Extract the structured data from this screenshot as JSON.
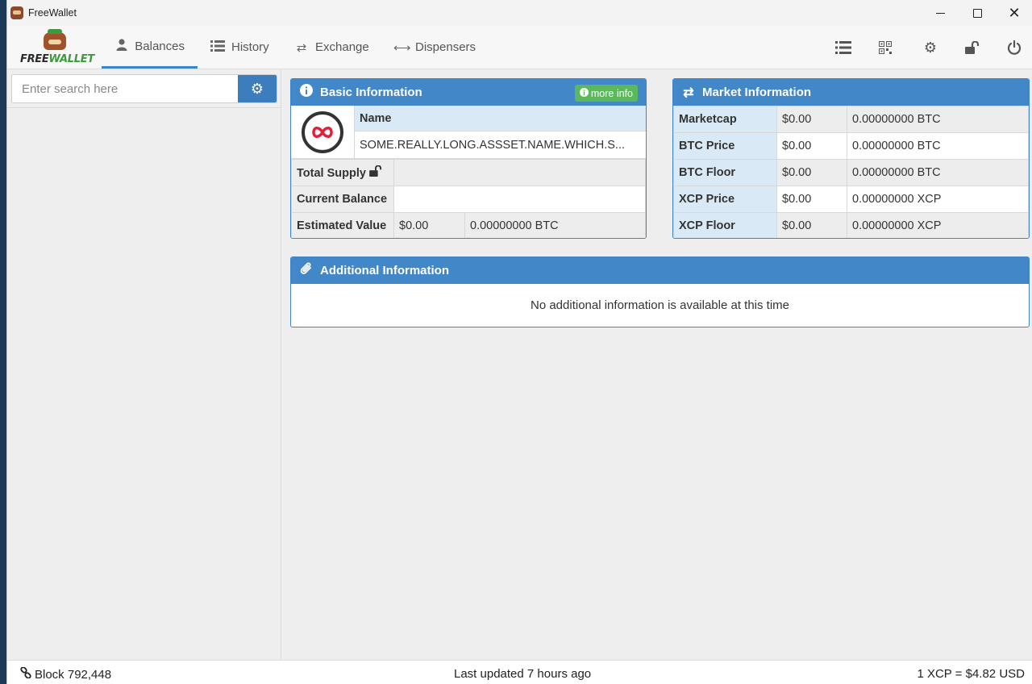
{
  "window": {
    "title": "FreeWallet",
    "icon": "freewallet-app-icon"
  },
  "logo": {
    "text_part1": "FREE",
    "text_part2": "WALLET"
  },
  "nav": {
    "tabs": [
      {
        "label": "Balances",
        "icon": "user-icon",
        "active": true
      },
      {
        "label": "History",
        "icon": "list-icon",
        "active": false
      },
      {
        "label": "Exchange",
        "icon": "exchange-arrows-icon",
        "active": false
      },
      {
        "label": "Dispensers",
        "icon": "left-right-arrow-icon",
        "active": false
      }
    ],
    "right_icons": [
      "list-icon",
      "qr-code-icon",
      "gears-icon",
      "unlock-icon",
      "power-icon"
    ]
  },
  "search": {
    "placeholder": "Enter search here"
  },
  "basic": {
    "title": "Basic Information",
    "more_info": "more info",
    "name_label": "Name",
    "name_value": "SOME.REALLY.LONG.ASSSET.NAME.WHICH.S...",
    "total_supply_label": "Total Supply",
    "current_balance_label": "Current Balance",
    "estimated_value_label": "Estimated Value",
    "estimated_usd": "$0.00",
    "estimated_btc": "0.00000000 BTC"
  },
  "market": {
    "title": "Market Information",
    "rows": [
      {
        "label": "Marketcap",
        "usd": "$0.00",
        "amount": "0.00000000 BTC"
      },
      {
        "label": "BTC Price",
        "usd": "$0.00",
        "amount": "0.00000000 BTC"
      },
      {
        "label": "BTC Floor",
        "usd": "$0.00",
        "amount": "0.00000000 BTC"
      },
      {
        "label": "XCP Price",
        "usd": "$0.00",
        "amount": "0.00000000 XCP"
      },
      {
        "label": "XCP Floor",
        "usd": "$0.00",
        "amount": "0.00000000 XCP"
      }
    ]
  },
  "additional": {
    "title": "Additional Information",
    "message": "No additional information is available at this time"
  },
  "footer": {
    "block": "Block 792,448",
    "updated": "Last updated 7 hours ago",
    "rate": "1 XCP = $4.82 USD"
  },
  "colors": {
    "accent": "#4287c8",
    "more_info_green": "#5cb85c",
    "background": "#eeeeee"
  }
}
